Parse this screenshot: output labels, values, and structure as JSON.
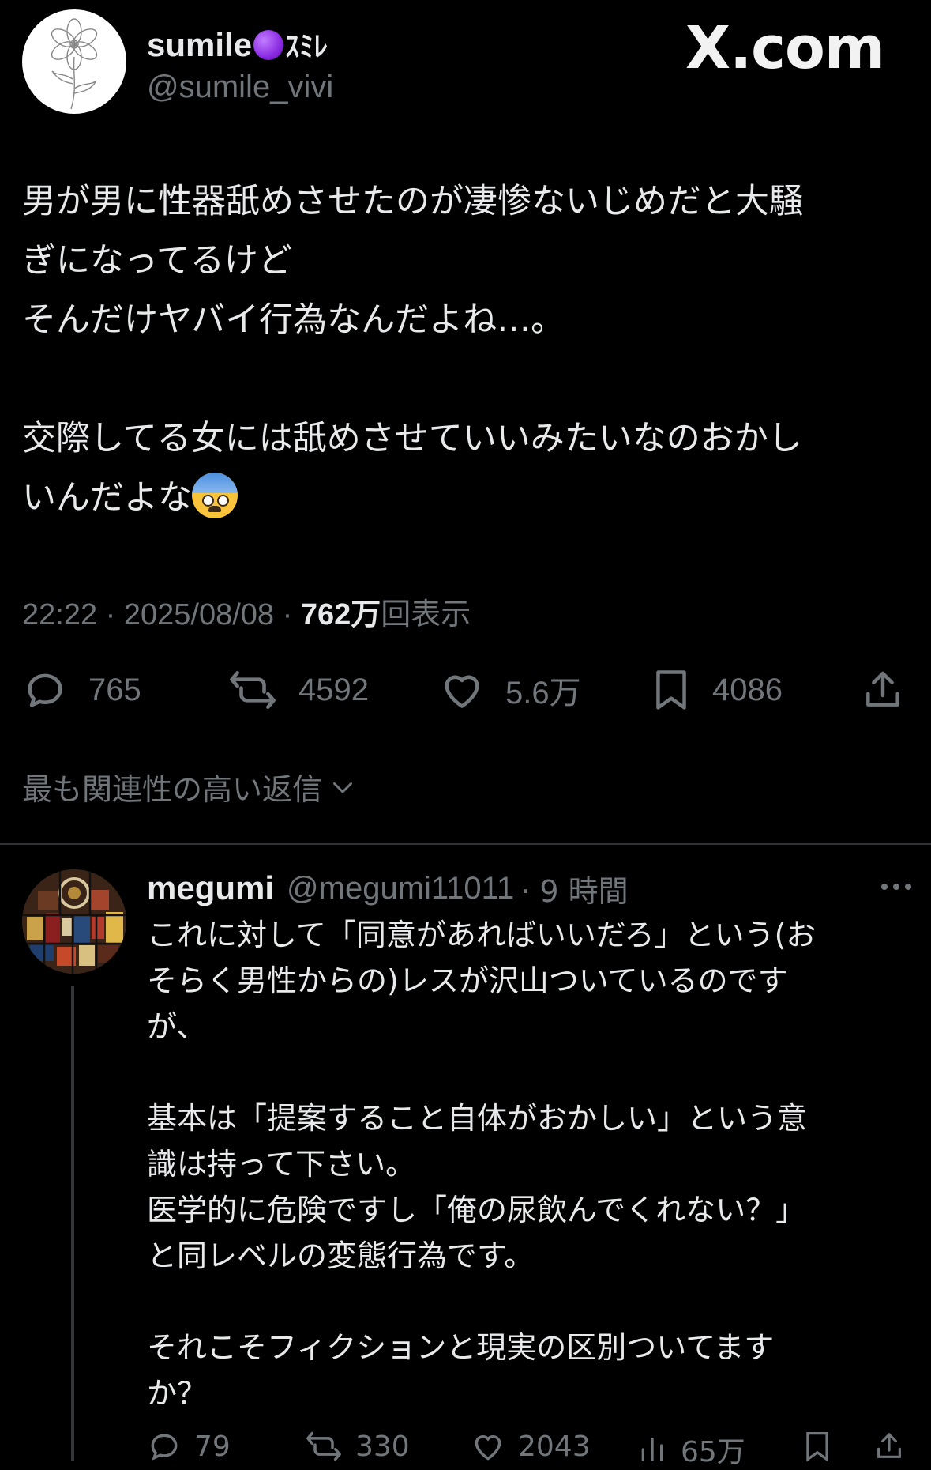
{
  "post": {
    "display_name": "sumile",
    "display_name_suffix": "ｽﾐﾚ",
    "handle": "@sumile_vivi",
    "brand": "X.com",
    "body": "男が男に性器舐めさせたのが凄惨ないじめだと大騒\nぎになってるけど\nそんだけヤバイ行為なんだよね…。\n\n交際してる女には舐めさせていいみたいなのおかし\nいんだよな",
    "time": "22:22",
    "date": "2025/08/08",
    "views_count": "762万",
    "views_label": "回表示",
    "separator": " · ",
    "actions": {
      "replies": "765",
      "reposts": "4592",
      "likes": "5.6万",
      "bookmarks": "4086"
    },
    "icons": [
      "reply-icon",
      "repost-icon",
      "like-icon",
      "bookmark-icon",
      "share-icon",
      "fearful-face-emoji"
    ]
  },
  "replies_sort": {
    "label": "最も関連性の高い返信"
  },
  "reply": {
    "name": "megumi",
    "handle": "@megumi11011",
    "time": "· 9 時間",
    "body": "これに対して「同意があればいいだろ」という(お\nそらく男性からの)レスが沢山ついているのです\nが、\n\n基本は「提案すること自体がおかしい」という意\n識は持って下さい。\n医学的に危険ですし「俺の尿飲んでくれない？」\nと同レベルの変態行為です。\n\nそれこそフィクションと現実の区別ついてます\nか？",
    "actions": {
      "replies": "79",
      "reposts": "330",
      "likes": "2043",
      "views": "65万"
    }
  },
  "colors": {
    "background": "#000000",
    "text": "#e7e9ea",
    "muted": "#71767b",
    "divider": "#2f3336"
  }
}
